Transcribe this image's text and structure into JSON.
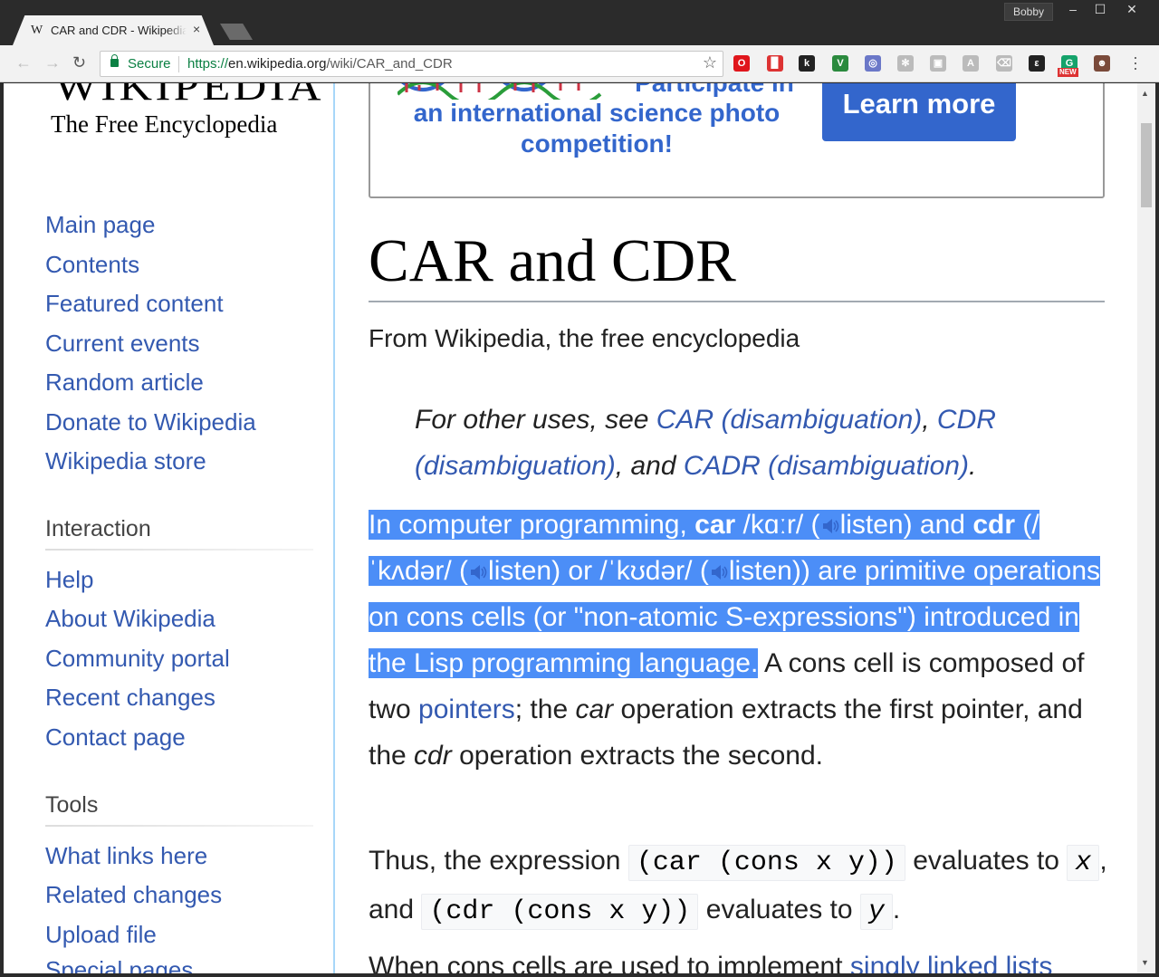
{
  "browser": {
    "tab_title": "CAR and CDR - Wikipedia",
    "tab_favicon": "W",
    "tab_close": "×",
    "user": "Bobby",
    "window_buttons": [
      "–",
      "☐",
      "✕"
    ],
    "secure_label": "Secure",
    "url_scheme": "https://",
    "url_host": "en.wikipedia.org",
    "url_path": "/wiki/CAR_and_CDR",
    "back": "←",
    "forward": "→",
    "reload": "↻",
    "bookmark_star": "☆",
    "extensions": [
      {
        "name": "opera-icon",
        "glyph": "O",
        "color": "#e0161c"
      },
      {
        "name": "pdf-icon",
        "glyph": "▉",
        "color": "#d33"
      },
      {
        "name": "k-icon",
        "glyph": "k",
        "color": "#222"
      },
      {
        "name": "v-icon",
        "glyph": "V",
        "color": "#2b8a3e"
      },
      {
        "name": "glasses-icon",
        "glyph": "◎",
        "color": "#6b78c8"
      },
      {
        "name": "react-icon",
        "glyph": "✻",
        "color": "#bbb"
      },
      {
        "name": "puzzle-icon",
        "glyph": "▣",
        "color": "#bbb"
      },
      {
        "name": "angular-icon",
        "glyph": "A",
        "color": "#bbb"
      },
      {
        "name": "dismiss-icon",
        "glyph": "⌫",
        "color": "#bbb"
      },
      {
        "name": "evernote-icon",
        "glyph": "ε",
        "color": "#222"
      },
      {
        "name": "grammarly-icon",
        "glyph": "G",
        "color": "#15a36b"
      },
      {
        "name": "avatar-icon",
        "glyph": "☻",
        "color": "#7a4a3a"
      }
    ],
    "new_badge": "NEW"
  },
  "sidebar": {
    "logo_word": "WIKIPEDIA",
    "logo_sub": "The Free Encyclopedia",
    "nav": [
      "Main page",
      "Contents",
      "Featured content",
      "Current events",
      "Random article",
      "Donate to Wikipedia",
      "Wikipedia store"
    ],
    "interaction_heading": "Interaction",
    "interaction": [
      "Help",
      "About Wikipedia",
      "Community portal",
      "Recent changes",
      "Contact page"
    ],
    "tools_heading": "Tools",
    "tools": [
      "What links here",
      "Related changes",
      "Upload file",
      "Special pages"
    ]
  },
  "banner": {
    "line1": "Participate in",
    "line2": "an international science photo competition!",
    "button": "Learn more"
  },
  "article": {
    "title": "CAR and CDR",
    "tagline": "From Wikipedia, the free encyclopedia",
    "hatnote": {
      "lead": "For other uses, see ",
      "link1": "CAR (disambiguation)",
      "comma": ", ",
      "link2": "CDR (disambiguation)",
      "and": ", and ",
      "link3": "CADR (disambiguation)",
      "end": "."
    },
    "p1": {
      "s1": "In computer programming, ",
      "car": "car",
      "ipa1_pre": " /",
      "ipa1": "kɑːr",
      "ipa1_post": "/ (",
      "listen": "listen",
      "s2": ") and ",
      "cdr": "cdr",
      "s3": " (/",
      "ipa2": "ˈkʌdər",
      "s4": "/ (",
      "s5": ") or /",
      "ipa3": "ˈkʊdər",
      "s6": "/ (",
      "s7": ")) are primitive operations on cons cells (or \"non-atomic S-expressions\") introduced in the ",
      "lisp": "Lisp programming language",
      "s8": ".",
      "s9": " A cons cell is composed of two ",
      "pointers": "pointers",
      "s10": "; the ",
      "car_i": "car",
      "s11": " operation extracts the first pointer, and the ",
      "cdr_i": "cdr",
      "s12": " operation extracts the second."
    },
    "p2": {
      "s1": "Thus, the expression ",
      "code1": "(car (cons x y))",
      "s2": " evaluates to ",
      "x": "x",
      "s3": ", and ",
      "code2": "(cdr (cons x y))",
      "s4": " evaluates to ",
      "y": "y",
      "s5": "."
    },
    "p3": {
      "s1": "When cons cells are used to implement ",
      "link": "singly linked lists"
    }
  },
  "colors": {
    "link": "#3359b0",
    "selection": "#4c8ef7",
    "banner_blue": "#3366cc"
  }
}
